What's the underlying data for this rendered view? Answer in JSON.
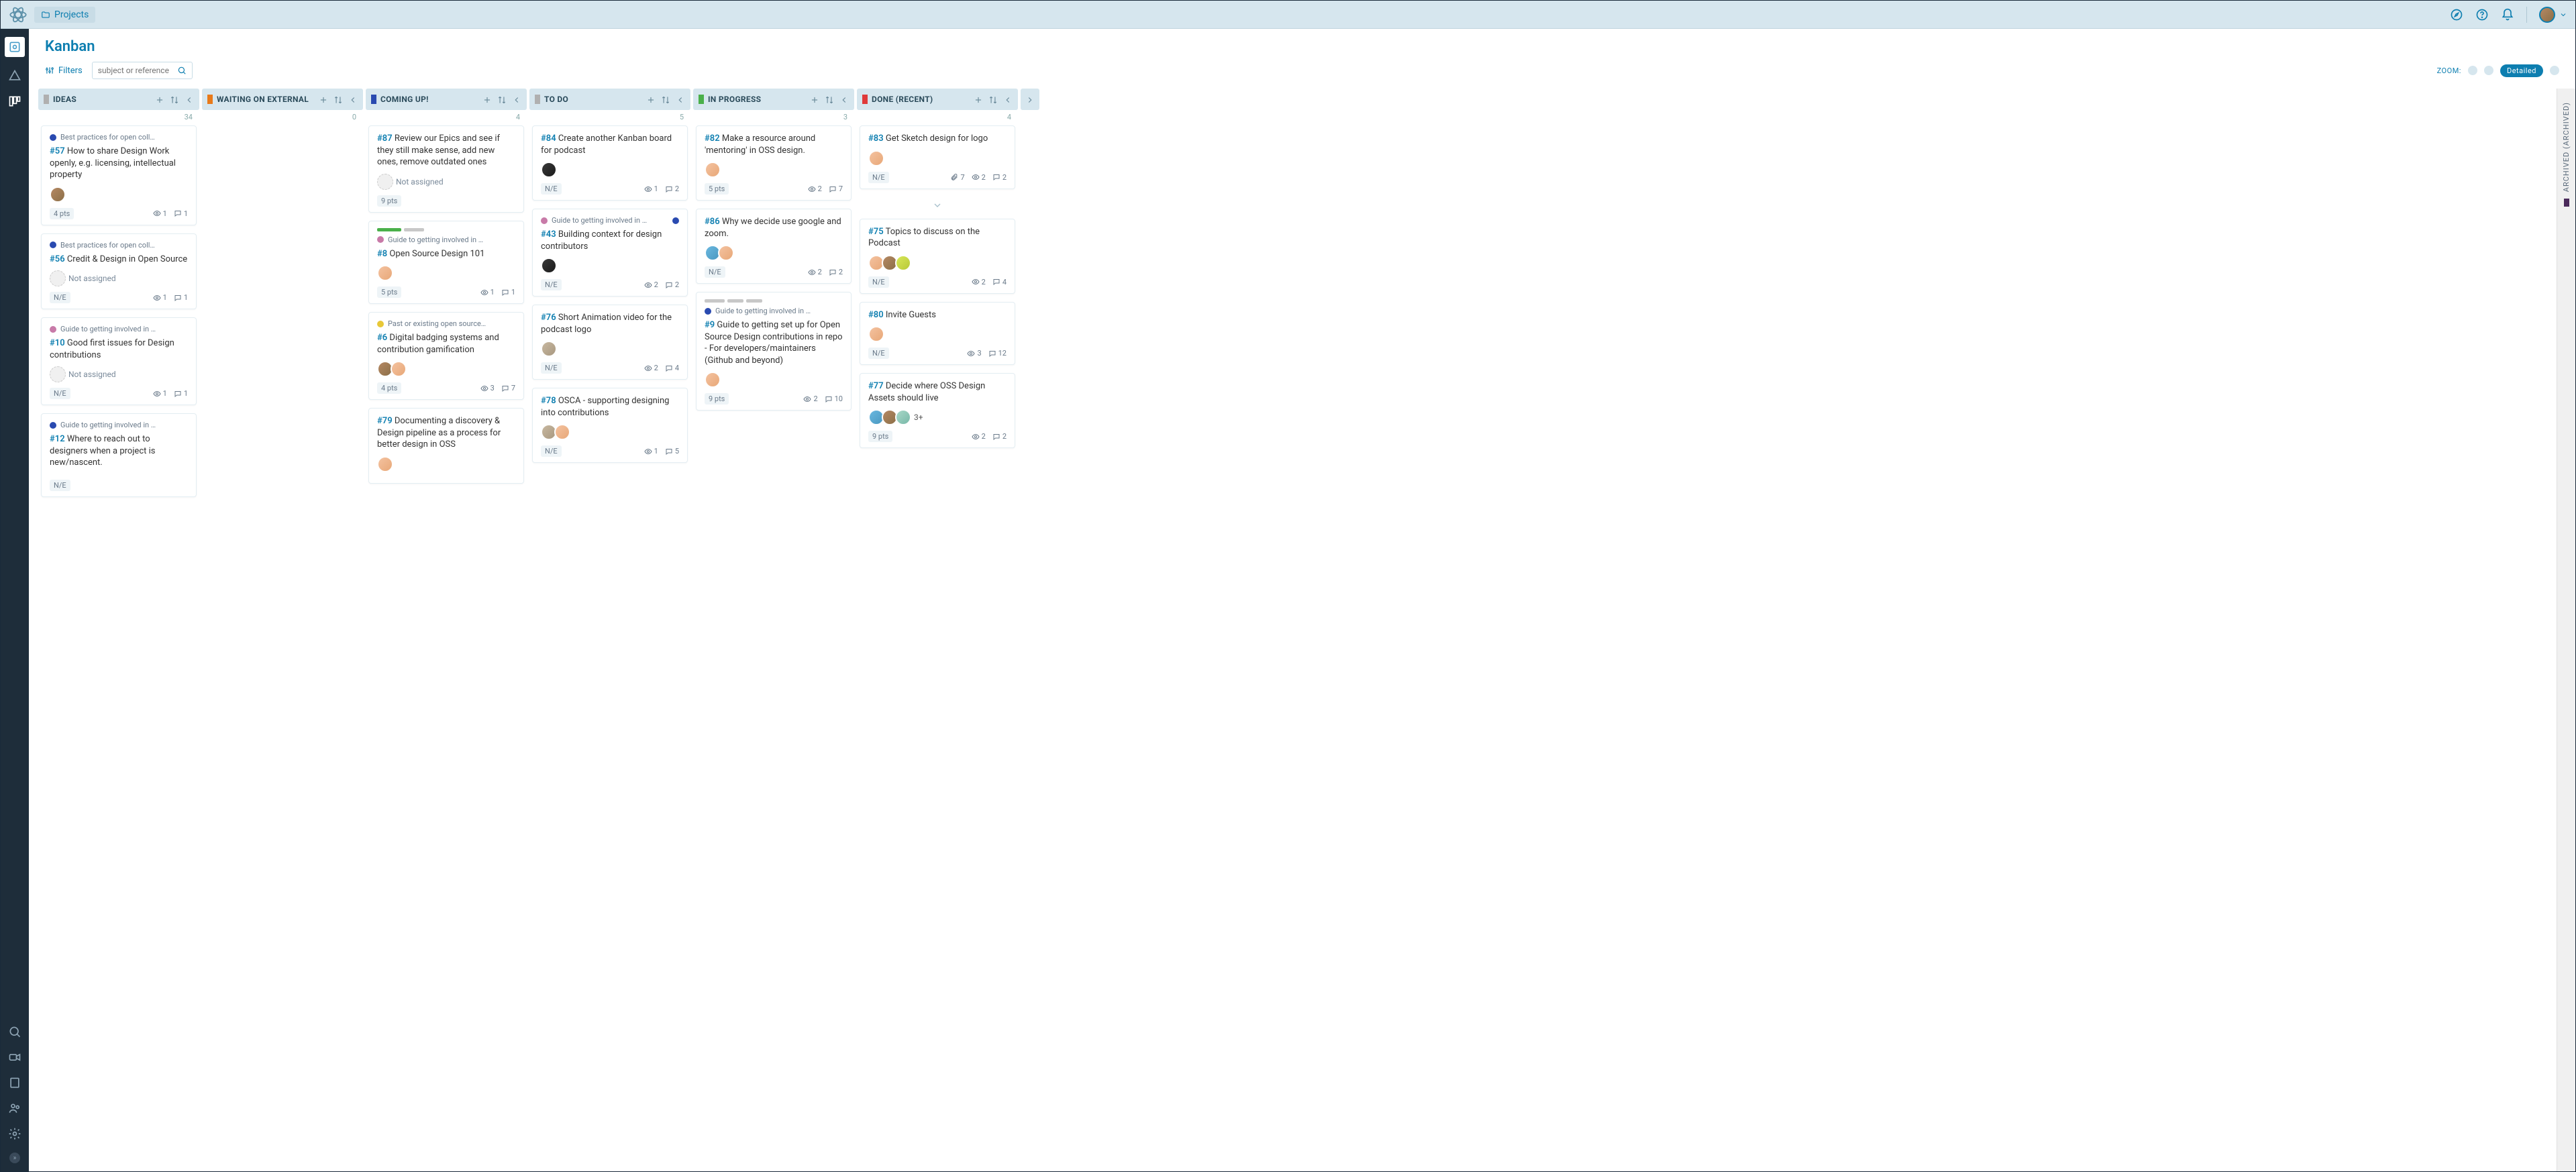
{
  "breadcrumb": {
    "label": "Projects"
  },
  "page": {
    "title": "Kanban"
  },
  "toolbar": {
    "filters_label": "Filters",
    "search_placeholder": "subject or reference",
    "zoom_label": "ZOOM:",
    "detailed_label": "Detailed"
  },
  "not_assigned_label": "Not assigned",
  "archived_label": "ARCHIVED (ARCHIVED)",
  "columns": [
    {
      "name": "IDEAS",
      "badge_color": "#b0b0b0",
      "count": "34",
      "cards": [
        {
          "tags": [
            {
              "color": "#2a4ab0",
              "text": "Best practices for open coll…"
            }
          ],
          "ref": "#57",
          "title": "How to share Design Work openly, e.g. licensing, intellectual property",
          "avatars": [
            "av1"
          ],
          "pts": "4 pts",
          "watchers": "1",
          "comments": "1"
        },
        {
          "tags": [
            {
              "color": "#2a4ab0",
              "text": "Best practices for open coll…"
            }
          ],
          "ref": "#56",
          "title": "Credit & Design in Open Source",
          "not_assigned": true,
          "pts": "N/E",
          "watchers": "1",
          "comments": "1"
        },
        {
          "tags": [
            {
              "color": "#c87aa8",
              "text": "Guide to getting involved in …"
            }
          ],
          "ref": "#10",
          "title": "Good first issues for Design contributions",
          "not_assigned": true,
          "pts": "N/E",
          "watchers": "1",
          "comments": "1"
        },
        {
          "tags": [
            {
              "color": "#2a4ab0",
              "text": "Guide to getting involved in …"
            }
          ],
          "ref": "#12",
          "title": "Where to reach out to designers when a project is new/nascent.",
          "avatars": [],
          "pts": "N/E"
        }
      ]
    },
    {
      "name": "WAITING ON EXTERNAL",
      "badge_color": "#e87a1a",
      "count": "0",
      "cards": []
    },
    {
      "name": "COMING UP!",
      "badge_color": "#2a4ab0",
      "count": "4",
      "cards": [
        {
          "ref": "#87",
          "title": "Review our Epics and see if they still make sense, add new ones, remove outdated ones",
          "not_assigned": true,
          "pts": "9 pts"
        },
        {
          "progress": [
            {
              "w": 36,
              "c": "#4ab04a"
            },
            {
              "w": 30,
              "c": "#c8c8c8"
            }
          ],
          "tags": [
            {
              "color": "#c87aa8",
              "text": "Guide to getting involved in …"
            }
          ],
          "ref": "#8",
          "title": "Open Source Design 101",
          "avatars": [
            "av3"
          ],
          "pts": "5 pts",
          "watchers": "1",
          "comments": "1"
        },
        {
          "tags": [
            {
              "color": "#e8c838",
              "text": "Past or existing open source…"
            }
          ],
          "ref": "#6",
          "title": "Digital badging systems and contribution gamification",
          "avatars": [
            "av1",
            "av3"
          ],
          "pts": "4 pts",
          "watchers": "3",
          "comments": "7"
        },
        {
          "ref": "#79",
          "title": "Documenting a discovery & Design pipeline as a process for better design in OSS",
          "avatars": [
            "av3"
          ]
        }
      ]
    },
    {
      "name": "TO DO",
      "badge_color": "#b0b0b0",
      "count": "5",
      "cards": [
        {
          "ref": "#84",
          "title": "Create another Kanban board for podcast",
          "avatars": [
            "av2"
          ],
          "pts": "N/E",
          "watchers": "1",
          "comments": "2"
        },
        {
          "tags": [
            {
              "color": "#c87aa8",
              "text": "Guide to getting involved in …"
            }
          ],
          "trailing_dot": "#2a4ab0",
          "ref": "#43",
          "title": "Building context for design contributors",
          "avatars": [
            "av2"
          ],
          "pts": "N/E",
          "watchers": "2",
          "comments": "2"
        },
        {
          "ref": "#76",
          "title": "Short Animation video for the podcast logo",
          "avatars": [
            "av7"
          ],
          "pts": "N/E",
          "watchers": "2",
          "comments": "4"
        },
        {
          "ref": "#78",
          "title": "OSCA - supporting designing into contributions",
          "avatars": [
            "av7",
            "av3"
          ],
          "pts": "N/E",
          "watchers": "1",
          "comments": "5"
        }
      ]
    },
    {
      "name": "IN PROGRESS",
      "badge_color": "#4ab04a",
      "count": "3",
      "cards": [
        {
          "ref": "#82",
          "title": "Make a resource around 'mentoring' in OSS design.",
          "avatars": [
            "av3"
          ],
          "pts": "5 pts",
          "watchers": "2",
          "comments": "7"
        },
        {
          "ref": "#86",
          "title": "Why we decide use google and zoom.",
          "avatars": [
            "av5",
            "av3"
          ],
          "pts": "N/E",
          "watchers": "2",
          "comments": "2"
        },
        {
          "progress": [
            {
              "w": 30,
              "c": "#c8c8c8"
            },
            {
              "w": 24,
              "c": "#c8c8c8"
            },
            {
              "w": 24,
              "c": "#c8c8c8"
            }
          ],
          "tags": [
            {
              "color": "#2a4ab0",
              "text": "Guide to getting involved in …"
            }
          ],
          "ref": "#9",
          "title": "Guide to getting set up for Open Source Design contributions in repo - For developers/maintainers (Github and beyond)",
          "avatars": [
            "av3"
          ],
          "pts": "9 pts",
          "watchers": "2",
          "comments": "10"
        }
      ]
    },
    {
      "name": "DONE (RECENT)",
      "badge_color": "#e03a3a",
      "count": "4",
      "cards": [
        {
          "ref": "#83",
          "title": "Get Sketch design for logo",
          "avatars": [
            "av3"
          ],
          "pts": "N/E",
          "attachments": "7",
          "watchers": "2",
          "comments": "2",
          "load_more": true
        },
        {
          "ref": "#75",
          "title": "Topics to discuss on the Podcast",
          "avatars": [
            "av3",
            "av1",
            "av6"
          ],
          "pts": "N/E",
          "watchers": "2",
          "comments": "4"
        },
        {
          "ref": "#80",
          "title": "Invite Guests",
          "avatars": [
            "av3"
          ],
          "pts": "N/E",
          "watchers": "3",
          "comments": "12"
        },
        {
          "ref": "#77",
          "title": "Decide where OSS Design Assets should live",
          "avatars": [
            "av5",
            "av1",
            "av4"
          ],
          "more": "3+",
          "pts": "9 pts",
          "watchers": "2",
          "comments": "2"
        }
      ]
    }
  ]
}
